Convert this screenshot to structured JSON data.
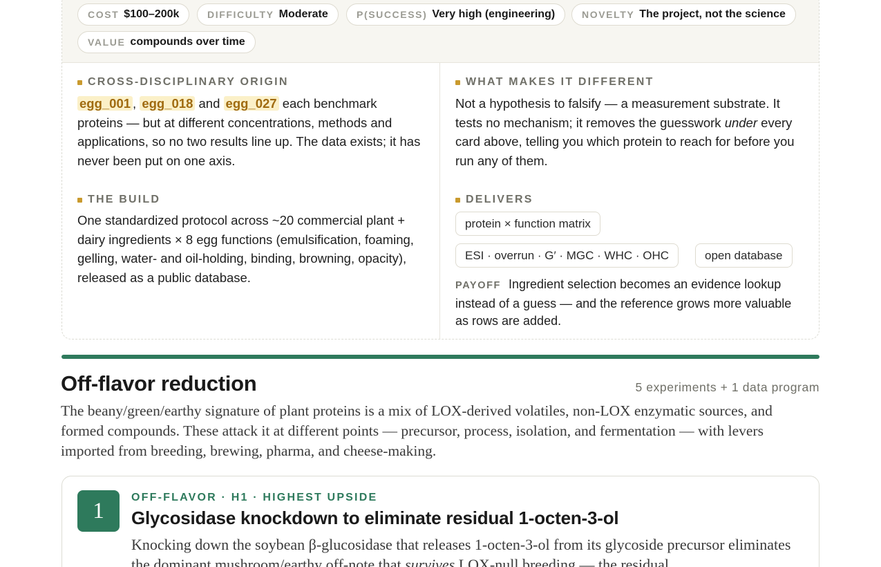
{
  "meta_pills": [
    {
      "key": "COST",
      "value": "$100–200k"
    },
    {
      "key": "DIFFICULTY",
      "value": "Moderate"
    },
    {
      "key": "P(SUCCESS)",
      "value": "Very high (engineering)"
    },
    {
      "key": "NOVELTY",
      "value": "The project, not the science"
    },
    {
      "key": "VALUE",
      "value": "compounds over time"
    }
  ],
  "origin": {
    "label": "CROSS-DISCIPLINARY ORIGIN",
    "refs": [
      "egg_001",
      "egg_018",
      "egg_027"
    ],
    "comma": ",",
    "and": "and",
    "text": "each benchmark proteins — but at different concentrations, methods and applications, so no two results line up. The data exists; it has never been put on one axis."
  },
  "different": {
    "label": "WHAT MAKES IT DIFFERENT",
    "text_before": "Not a hypothesis to falsify — a measurement substrate. It tests no mechanism; it removes the guesswork",
    "emphasis": "under",
    "text_after": "every card above, telling you which protein to reach for before you run any of them."
  },
  "build": {
    "label": "THE BUILD",
    "text": "One standardized protocol across ~20 commercial plant + dairy ingredients × 8 egg functions (emulsification, foaming, gelling, water- and oil-holding, binding, browning, opacity), released as a public database."
  },
  "delivers": {
    "label": "DELIVERS",
    "tags": [
      "protein × function matrix",
      "ESI · overrun · G′ · MGC · WHC · OHC",
      "open database"
    ],
    "payoff_label": "PAYOFF",
    "payoff_text": "Ingredient selection becomes an evidence lookup instead of a guess — and the reference grows more valuable as rows are added."
  },
  "section": {
    "title": "Off-flavor reduction",
    "count": "5 experiments + 1 data program",
    "description": "The beany/green/earthy signature of plant proteins is a mix of LOX-derived volatiles, non-LOX enzymatic sources, and formed compounds. These attack it at different points — precursor, process, isolation, and fermentation — with levers imported from breeding, brewing, pharma, and cheese-making."
  },
  "experiment": {
    "number": "1",
    "kicker": "OFF-FLAVOR · H1 · HIGHEST UPSIDE",
    "title": "Glycosidase knockdown to eliminate residual 1-octen-3-ol",
    "desc_before": "Knocking down the soybean β-glucosidase that releases 1-octen-3-ol from its glycoside precursor eliminates the dominant mushroom/earthy off-note that",
    "desc_emphasis": "survives",
    "desc_after": "LOX-null breeding — the residual"
  },
  "colors": {
    "accent_green": "#2e7a5c",
    "accent_gold": "#c99a2e",
    "highlight_bg": "#fbf0c8"
  }
}
